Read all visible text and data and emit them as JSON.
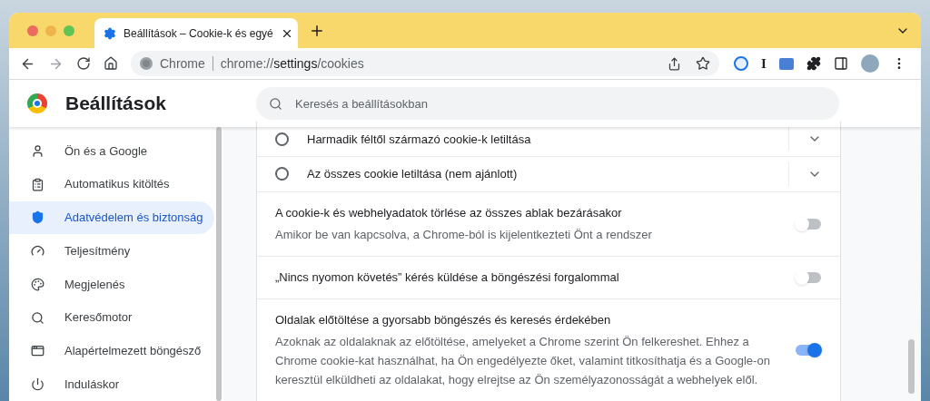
{
  "tabs": [
    {
      "title": "Beállítások – Cookie-k és egyé",
      "selected": true
    }
  ],
  "toolbar": {
    "url_origin": "Chrome",
    "url_prefix": "chrome://",
    "url_host": "settings",
    "url_path": "/cookies",
    "profile_initial": "I"
  },
  "header": {
    "title": "Beállítások",
    "search": {
      "placeholder": "Keresés a beállításokban"
    }
  },
  "sidebar": {
    "items": [
      {
        "label": "Ön és a Google",
        "selected": false
      },
      {
        "label": "Automatikus kitöltés",
        "selected": false
      },
      {
        "label": "Adatvédelem és biztonság",
        "selected": true
      },
      {
        "label": "Teljesítmény",
        "selected": false
      },
      {
        "label": "Megjelenés",
        "selected": false
      },
      {
        "label": "Keresőmotor",
        "selected": false
      },
      {
        "label": "Alapértelmezett böngésző",
        "selected": false
      },
      {
        "label": "Induláskor",
        "selected": false
      }
    ]
  },
  "radio_options": [
    {
      "label": "Harmadik féltől származó cookie-k letiltása",
      "selected": false
    },
    {
      "label": "Az összes cookie letiltása (nem ajánlott)",
      "selected": false
    }
  ],
  "toggles": [
    {
      "title": "A cookie-k és webhelyadatok törlése az összes ablak bezárásakor",
      "description": "Amikor be van kapcsolva, a Chrome-ból is kijelentkezteti Önt a rendszer",
      "on": false
    },
    {
      "title": "„Nincs nyomon követés” kérés küldése a böngészési forgalommal",
      "on": false
    },
    {
      "title": "Oldalak előtöltése a gyorsabb böngészés és keresés érdekében",
      "description": "Azoknak az oldalaknak az előtöltése, amelyeket a Chrome szerint Ön felkereshet. Ehhez a Chrome cookie-kat használhat, ha Ön engedélyezte őket, valamint titkosíthatja és a Google-on keresztül elküldheti az oldalakat, hogy elrejtse az Ön személyazonosságát a webhelyek elől.",
      "on": true
    }
  ]
}
